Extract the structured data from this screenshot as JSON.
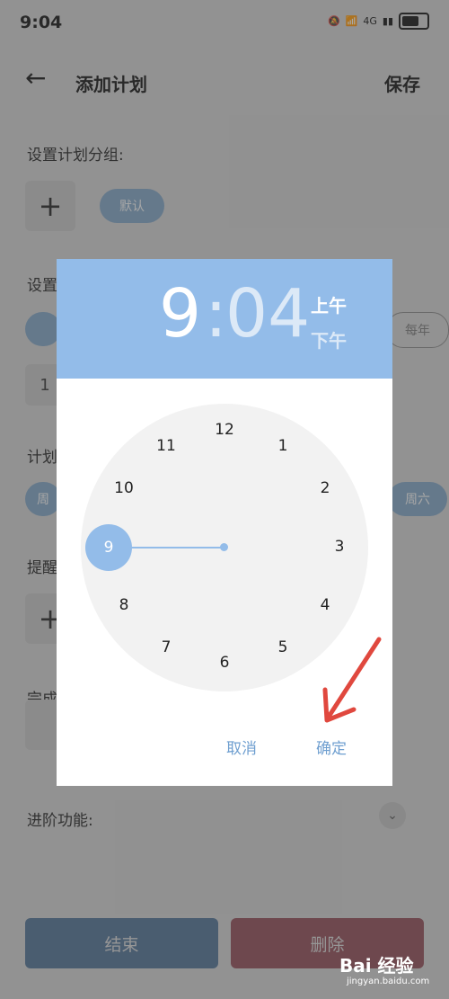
{
  "status_bar": {
    "time": "9:04",
    "network": "4G"
  },
  "header": {
    "title": "添加计划",
    "save": "保存"
  },
  "background": {
    "group_label": "设置计划分组:",
    "group_chip": "默认",
    "repeat_label_fragment": "设置",
    "repeat_chip_fragment": "每年",
    "repeat_count_fragment": "1",
    "weekday_label_fragment": "计划",
    "weekday_first_fragment": "周",
    "weekday_last": "周六",
    "reminder_label_fragment": "提醒",
    "complete_label_fragment": "完成",
    "advanced_label": "进阶功能:",
    "end_button": "结束",
    "delete_button": "删除"
  },
  "time_picker": {
    "hour": "9",
    "separator": ":",
    "minute": "04",
    "am": "上午",
    "pm": "下午",
    "selected_hour": "9",
    "clock_numbers": [
      "12",
      "1",
      "2",
      "3",
      "4",
      "5",
      "6",
      "7",
      "8",
      "10",
      "11"
    ],
    "cancel": "取消",
    "ok": "确定"
  },
  "watermark": {
    "logo": "Bai 经验",
    "url": "jingyan.baidu.com"
  },
  "colors": {
    "accent": "#93bce9",
    "action_text": "#6f9fd0",
    "arrow": "#e0483e"
  },
  "icons": {
    "back": "arrow-left-icon",
    "add": "plus-icon",
    "expand": "chevron-down-icon"
  }
}
